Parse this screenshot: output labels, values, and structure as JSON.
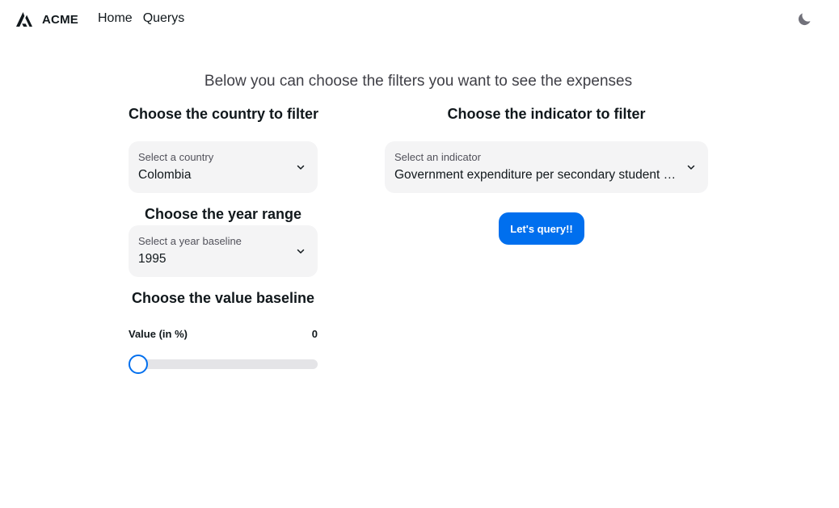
{
  "navbar": {
    "brand": "ACME",
    "links": [
      "Home",
      "Querys"
    ],
    "theme_icon": "moon-icon"
  },
  "headline": "Below you can choose the filters you want to see the expenses",
  "country": {
    "title": "Choose the country to filter",
    "label": "Select a country",
    "value": "Colombia"
  },
  "indicator": {
    "title": "Choose the indicator to filter",
    "label": "Select an indicator",
    "value": "Government expenditure per secondary student (% of GDP per capita)"
  },
  "year": {
    "title": "Choose the year range",
    "label": "Select a year baseline",
    "value": "1995"
  },
  "value_baseline": {
    "title": "Choose the value baseline",
    "label": "Value (in %)",
    "value": "0",
    "fraction": 0
  },
  "query_button": "Let's query!!",
  "colors": {
    "primary": "#006fee",
    "field_bg": "#f4f4f5",
    "text": "#11181c"
  }
}
